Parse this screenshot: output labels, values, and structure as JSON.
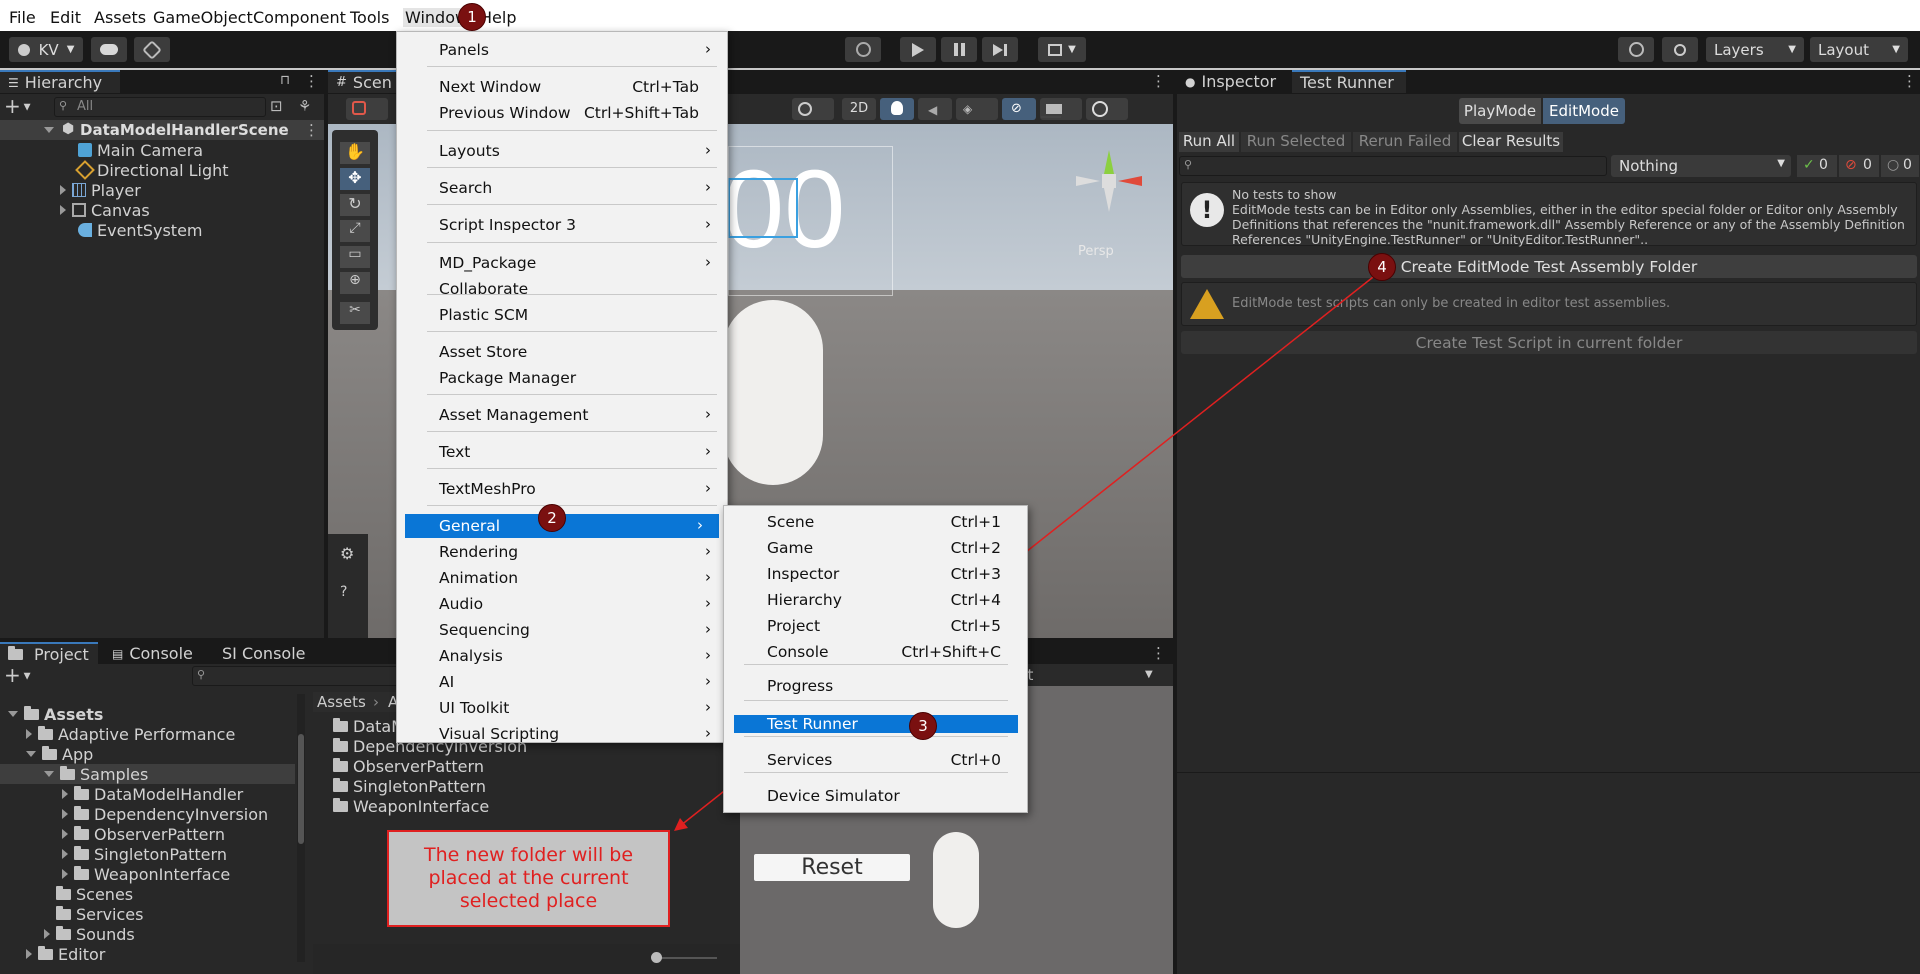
{
  "menubar": {
    "items": [
      "File",
      "Edit",
      "Assets",
      "GameObject",
      "Component",
      "Tools",
      "Window",
      "Help"
    ]
  },
  "toolbar": {
    "account": "KV",
    "layers": "Layers",
    "layout": "Layout"
  },
  "hierarchy": {
    "tab": "Hierarchy",
    "search_placeholder": "All",
    "scene": "DataModelHandlerScene",
    "items": [
      "Main Camera",
      "Directional Light",
      "Player",
      "Canvas",
      "EventSystem"
    ]
  },
  "scene": {
    "tab": "Scen",
    "persp": "Persp",
    "mode_2d": "2D",
    "game_digit": "00",
    "reset_label": "Reset",
    "ect_label": "ect"
  },
  "window_menu": {
    "items": [
      {
        "label": "Panels",
        "shortcut": "",
        "arrow": "›"
      },
      {
        "label": "Next Window",
        "shortcut": "Ctrl+Tab",
        "arrow": ""
      },
      {
        "label": "Previous Window",
        "shortcut": "Ctrl+Shift+Tab",
        "arrow": ""
      },
      {
        "label": "Layouts",
        "shortcut": "",
        "arrow": "›"
      },
      {
        "label": "Search",
        "shortcut": "",
        "arrow": "›"
      },
      {
        "label": "Script Inspector 3",
        "shortcut": "",
        "arrow": "›"
      },
      {
        "label": "MD_Package",
        "shortcut": "",
        "arrow": "›"
      },
      {
        "label": "Collaborate",
        "shortcut": "",
        "arrow": ""
      },
      {
        "label": "Plastic SCM",
        "shortcut": "",
        "arrow": ""
      },
      {
        "label": "Asset Store",
        "shortcut": "",
        "arrow": ""
      },
      {
        "label": "Package Manager",
        "shortcut": "",
        "arrow": ""
      },
      {
        "label": "Asset Management",
        "shortcut": "",
        "arrow": "›"
      },
      {
        "label": "Text",
        "shortcut": "",
        "arrow": "›"
      },
      {
        "label": "TextMeshPro",
        "shortcut": "",
        "arrow": "›"
      },
      {
        "label": "General",
        "shortcut": "",
        "arrow": "›"
      },
      {
        "label": "Rendering",
        "shortcut": "",
        "arrow": "›"
      },
      {
        "label": "Animation",
        "shortcut": "",
        "arrow": "›"
      },
      {
        "label": "Audio",
        "shortcut": "",
        "arrow": "›"
      },
      {
        "label": "Sequencing",
        "shortcut": "",
        "arrow": "›"
      },
      {
        "label": "Analysis",
        "shortcut": "",
        "arrow": "›"
      },
      {
        "label": "AI",
        "shortcut": "",
        "arrow": "›"
      },
      {
        "label": "UI Toolkit",
        "shortcut": "",
        "arrow": "›"
      },
      {
        "label": "Visual Scripting",
        "shortcut": "",
        "arrow": "›"
      }
    ]
  },
  "general_menu": {
    "items": [
      {
        "label": "Scene",
        "shortcut": "Ctrl+1"
      },
      {
        "label": "Game",
        "shortcut": "Ctrl+2"
      },
      {
        "label": "Inspector",
        "shortcut": "Ctrl+3"
      },
      {
        "label": "Hierarchy",
        "shortcut": "Ctrl+4"
      },
      {
        "label": "Project",
        "shortcut": "Ctrl+5"
      },
      {
        "label": "Console",
        "shortcut": "Ctrl+Shift+C"
      },
      {
        "label": "Progress",
        "shortcut": ""
      },
      {
        "label": "Test Runner",
        "shortcut": ""
      },
      {
        "label": "Services",
        "shortcut": "Ctrl+0"
      },
      {
        "label": "Device Simulator",
        "shortcut": ""
      }
    ]
  },
  "steps": [
    "1",
    "2",
    "3",
    "4"
  ],
  "inspector": {
    "tabs": [
      "Inspector",
      "Test Runner"
    ],
    "modes": [
      "PlayMode",
      "EditMode"
    ],
    "actions": [
      "Run All",
      "Run Selected",
      "Rerun Failed",
      "Clear Results"
    ],
    "filter": "Nothing",
    "counts": [
      "0",
      "0",
      "0"
    ],
    "info_title": "No tests to show",
    "info_body": "EditMode tests can be in Editor only Assemblies, either in the editor special folder or Editor only Assembly Definitions that references the \"nunit.framework.dll\" Assembly Reference or any of the Assembly Definition References \"UnityEngine.TestRunner\" or \"UnityEditor.TestRunner\"..",
    "create_folder": "Create EditMode Test Assembly Folder",
    "warn": "EditMode test scripts can only be created in editor test assemblies.",
    "create_script": "Create Test Script in current folder"
  },
  "project": {
    "tabs": [
      "Project",
      "Console",
      "SI Console"
    ],
    "tree": [
      {
        "label": "Assets",
        "depth": 0,
        "open": true,
        "arrow": true
      },
      {
        "label": "Adaptive Performance",
        "depth": 1,
        "open": false,
        "arrow": true
      },
      {
        "label": "App",
        "depth": 1,
        "open": true,
        "arrow": true
      },
      {
        "label": "Samples",
        "depth": 2,
        "open": true,
        "arrow": true
      },
      {
        "label": "DataModelHandler",
        "depth": 3,
        "open": false,
        "arrow": true
      },
      {
        "label": "DependencyInversion",
        "depth": 3,
        "open": false,
        "arrow": true
      },
      {
        "label": "ObserverPattern",
        "depth": 3,
        "open": false,
        "arrow": true
      },
      {
        "label": "SingletonPattern",
        "depth": 3,
        "open": false,
        "arrow": true
      },
      {
        "label": "WeaponInterface",
        "depth": 3,
        "open": false,
        "arrow": true
      },
      {
        "label": "Scenes",
        "depth": 2,
        "open": false,
        "arrow": false
      },
      {
        "label": "Services",
        "depth": 2,
        "open": false,
        "arrow": false
      },
      {
        "label": "Sounds",
        "depth": 2,
        "open": false,
        "arrow": true
      },
      {
        "label": "Editor",
        "depth": 1,
        "open": false,
        "arrow": true
      }
    ],
    "breadcrumb_root": "Assets",
    "breadcrumb_next": "A",
    "files": [
      "DataM",
      "DependencyInversion",
      "ObserverPattern",
      "SingletonPattern",
      "WeaponInterface"
    ]
  },
  "annotation": "The new folder will be placed at the current selected place"
}
